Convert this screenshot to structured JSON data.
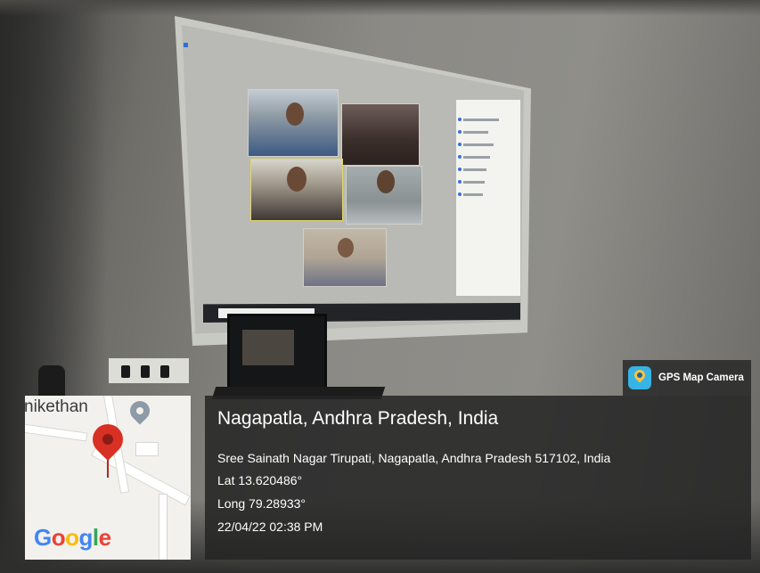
{
  "gps_badge": {
    "app_name": "GPS Map Camera",
    "icon": "gps-map-camera-icon"
  },
  "location": {
    "place": "Nagapatla, Andhra Pradesh, India",
    "address": "Sree Sainath Nagar Tirupati, Nagapatla, Andhra Pradesh 517102, India",
    "latitude": "Lat 13.620486°",
    "longitude": "Long 79.28933°",
    "datetime": "22/04/22 02:38 PM"
  },
  "map": {
    "label": "nikethan",
    "provider": "Google",
    "pin_icon": "map-pin-icon",
    "colors": {
      "pin": "#d93025",
      "overlay": "#242424"
    }
  }
}
